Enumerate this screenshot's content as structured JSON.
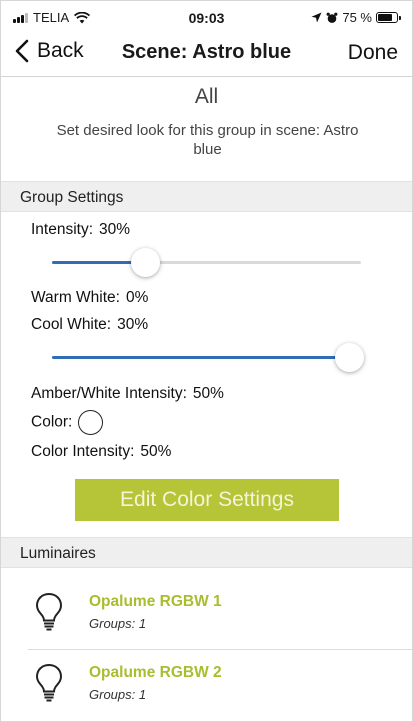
{
  "status_bar": {
    "carrier": "TELIA",
    "time": "09:03",
    "battery_percent": "75 %",
    "battery_level": 0.75
  },
  "nav": {
    "back_label": "Back",
    "title": "Scene: Astro blue",
    "done_label": "Done"
  },
  "group": {
    "name": "All",
    "description": "Set desired look for this group in scene: Astro blue"
  },
  "group_settings": {
    "header": "Group Settings",
    "intensity_label": "Intensity:",
    "intensity_value": "30%",
    "intensity_slider_level": 0.3,
    "warm_white_label": "Warm White:",
    "warm_white_value": "0%",
    "cool_white_label": "Cool White:",
    "cool_white_value": "30%",
    "cool_white_slider_level": 0.96,
    "amber_label": "Amber/White Intensity:",
    "amber_value": "50%",
    "color_label": "Color:",
    "color_intensity_label": "Color Intensity:",
    "color_intensity_value": "50%",
    "edit_button_label": "Edit Color Settings"
  },
  "luminaires": {
    "header": "Luminaires",
    "items": [
      {
        "name": "Opalume RGBW 1",
        "groups": "Groups: 1",
        "icon": "lightbulb-icon"
      },
      {
        "name": "Opalume RGBW 2",
        "groups": "Groups: 1",
        "icon": "lightbulb-icon"
      }
    ]
  },
  "colors": {
    "accent_green": "#b6c438",
    "luminaire_name": "#a9bd2e",
    "slider_blue": "#2f6db5"
  }
}
